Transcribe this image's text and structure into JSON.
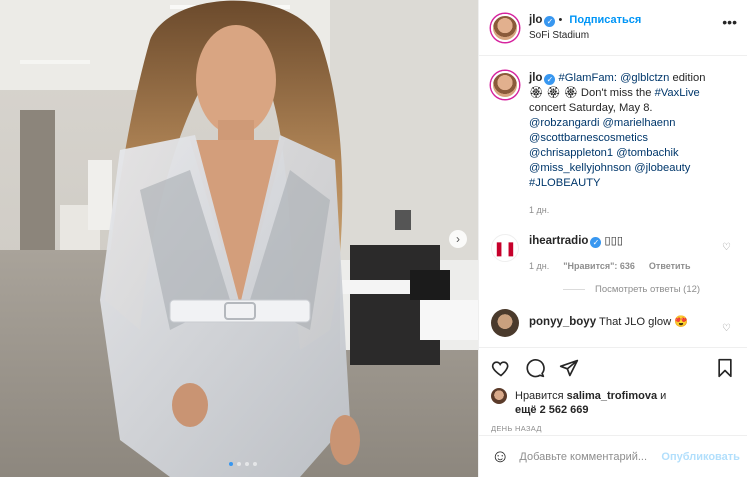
{
  "post": {
    "username": "jlo",
    "follow_label": "Подписаться",
    "location": "SoFi Stadium"
  },
  "caption": {
    "username": "jlo",
    "text_parts": [
      "#GlamFam: @glblctzn edition",
      "🏵 🏵 🏵 Don't miss the #VaxLive concert Saturday, May 8.",
      "@robzangardi @marielhaenn @scottbarnescosmetics @chrisappleton1 @tombachik @miss_kellyjohnson @jlobeauty #JLOBEAUTY"
    ],
    "tag1": "#GlamFam: @glblctzn",
    "plain1": " edition",
    "line2a": "🏵 🏵 🏵 Don't miss the ",
    "tag2": "#VaxLive",
    "line2b": " concert Saturday, May 8.",
    "mentions": "@robzangardi @marielhaenn @scottbarnescosmetics @chrisappleton1 @tombachik @miss_kellyjohnson @jlobeauty #JLOBEAUTY",
    "time": "1 дн."
  },
  "comments": [
    {
      "username": "iheartradio",
      "text": "▯▯▯",
      "time": "1 дн.",
      "likes": "\"Нравится\": 636",
      "reply": "Ответить",
      "view_replies": "Посмотреть ответы (12)"
    },
    {
      "username": "ponyy_boyy",
      "text": "That JLO glow 😍"
    }
  ],
  "likes": {
    "line1_prefix": "Нравится ",
    "liker": "salima_trofimova",
    "line1_suffix": " и",
    "line2": "ещё 2 562 669"
  },
  "post_date": "ДЕНЬ НАЗАД",
  "add_comment": {
    "placeholder": "Добавьте комментарий...",
    "publish": "Опубликовать"
  },
  "icons": {
    "more": "more-icon",
    "like": "heart-icon",
    "comment": "comment-icon",
    "share": "share-icon",
    "save": "bookmark-icon",
    "emoji": "emoji-icon",
    "next": "chevron-right-icon"
  },
  "colors": {
    "link": "#00376b",
    "follow": "#0095f6",
    "verified": "#3897f0",
    "muted": "#8e8e8e"
  },
  "carousel": {
    "count": 4,
    "active": 1
  }
}
